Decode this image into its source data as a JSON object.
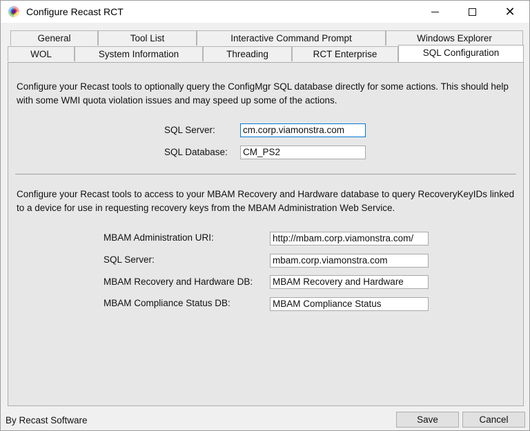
{
  "window": {
    "title": "Configure Recast RCT",
    "minimize": "",
    "maximize": "",
    "close": "✕"
  },
  "tabs_back_row": [
    {
      "label": "General"
    },
    {
      "label": "Tool List"
    },
    {
      "label": "Interactive Command Prompt"
    },
    {
      "label": "Windows Explorer"
    }
  ],
  "tabs_front_row": [
    {
      "label": "WOL"
    },
    {
      "label": "System Information"
    },
    {
      "label": "Threading"
    },
    {
      "label": "RCT Enterprise"
    },
    {
      "label": "SQL Configuration",
      "active": true
    }
  ],
  "sql_section": {
    "description": "Configure your Recast tools to optionally query the ConfigMgr SQL database directly for some actions. This should help with some WMI quota violation issues and may speed up some of the actions.",
    "server_label": "SQL Server:",
    "server_value": "cm.corp.viamonstra.com",
    "database_label": "SQL Database:",
    "database_value": "CM_PS2"
  },
  "mbam_section": {
    "description": "Configure your Recast tools to access to your MBAM Recovery and Hardware database to query RecoveryKeyIDs linked to a device for use in requesting recovery keys from the MBAM Administration Web Service.",
    "admin_uri_label": "MBAM Administration URI:",
    "admin_uri_value": "http://mbam.corp.viamonstra.com/",
    "sql_server_label": "SQL Server:",
    "sql_server_value": "mbam.corp.viamonstra.com",
    "recovery_db_label": "MBAM Recovery and Hardware DB:",
    "recovery_db_value": "MBAM Recovery and Hardware",
    "compliance_db_label": "MBAM Compliance Status DB:",
    "compliance_db_value": "MBAM Compliance Status"
  },
  "footer": {
    "credit": "By Recast Software",
    "save_label": "Save",
    "cancel_label": "Cancel"
  }
}
